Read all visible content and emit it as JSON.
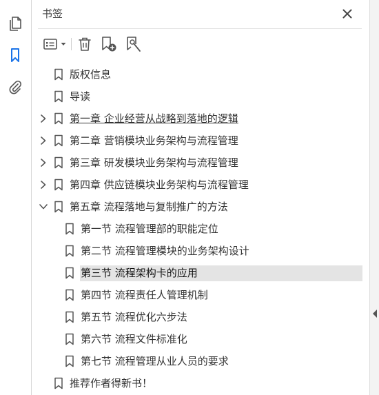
{
  "panel": {
    "title": "书签"
  },
  "tree": [
    {
      "label": "版权信息",
      "level": 0,
      "expandable": false
    },
    {
      "label": "导读",
      "level": 0,
      "expandable": false
    },
    {
      "label": "第一章 企业经营从战略到落地的逻辑",
      "level": 0,
      "expandable": true,
      "expanded": false,
      "hover": true
    },
    {
      "label": "第二章 营销模块业务架构与流程管理",
      "level": 0,
      "expandable": true,
      "expanded": false
    },
    {
      "label": "第三章 研发模块业务架构与流程管理",
      "level": 0,
      "expandable": true,
      "expanded": false
    },
    {
      "label": "第四章 供应链模块业务架构与流程管理",
      "level": 0,
      "expandable": true,
      "expanded": false
    },
    {
      "label": "第五章 流程落地与复制推广的方法",
      "level": 0,
      "expandable": true,
      "expanded": true
    },
    {
      "label": "第一节 流程管理部的职能定位",
      "level": 1,
      "expandable": false
    },
    {
      "label": "第二节 流程管理模块的业务架构设计",
      "level": 1,
      "expandable": false
    },
    {
      "label": "第三节 流程架构卡的应用",
      "level": 1,
      "expandable": false,
      "selected": true
    },
    {
      "label": "第四节 流程责任人管理机制",
      "level": 1,
      "expandable": false
    },
    {
      "label": "第五节 流程优化六步法",
      "level": 1,
      "expandable": false
    },
    {
      "label": "第六节 流程文件标准化",
      "level": 1,
      "expandable": false
    },
    {
      "label": "第七节 流程管理从业人员的要求",
      "level": 1,
      "expandable": false
    },
    {
      "label": "推荐作者得新书！",
      "level": 0,
      "expandable": false
    }
  ],
  "colors": {
    "accent": "#1a73e8",
    "selected_bg": "#e4e4e4",
    "icon": "#555555"
  }
}
